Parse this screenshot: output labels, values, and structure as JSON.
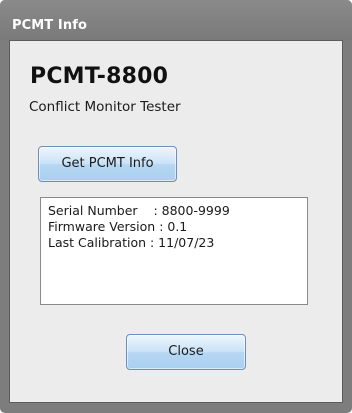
{
  "window": {
    "title": "PCMT Info"
  },
  "header": {
    "app_name": "PCMT-8800",
    "subtitle": "Conflict Monitor Tester"
  },
  "buttons": {
    "get_info_label": "Get PCMT Info",
    "close_label": "Close"
  },
  "info_box": {
    "lines": [
      "Serial Number    : 8800-9999",
      "Firmware Version : 0.1",
      "Last Calibration : 11/07/23"
    ]
  },
  "colors": {
    "title_bar": "#7d7d7d",
    "client_bg": "#ececec",
    "button_blue": "#b7d7f3"
  }
}
